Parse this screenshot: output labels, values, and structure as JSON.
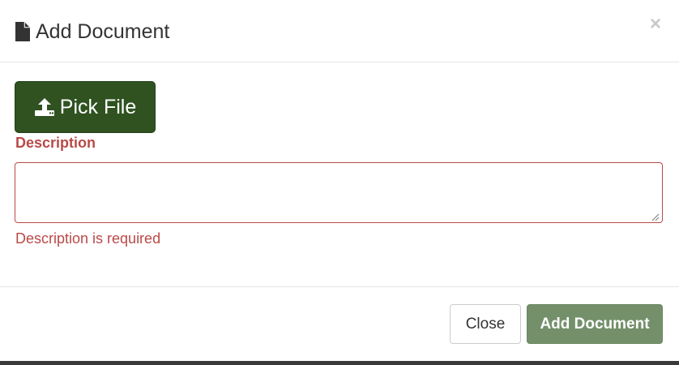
{
  "dialog": {
    "title": "Add Document",
    "title_icon": "file-icon",
    "close_glyph": "×"
  },
  "body": {
    "pick_file_label": "Pick File",
    "pick_file_icon": "upload-icon",
    "description_label": "Description",
    "description_value": "",
    "description_error": "Description is required"
  },
  "footer": {
    "close_label": "Close",
    "add_label": "Add Document"
  },
  "colors": {
    "pick_file_bg": "#2f5220",
    "error_red": "#b94a48",
    "add_button_bg": "#73906b"
  }
}
